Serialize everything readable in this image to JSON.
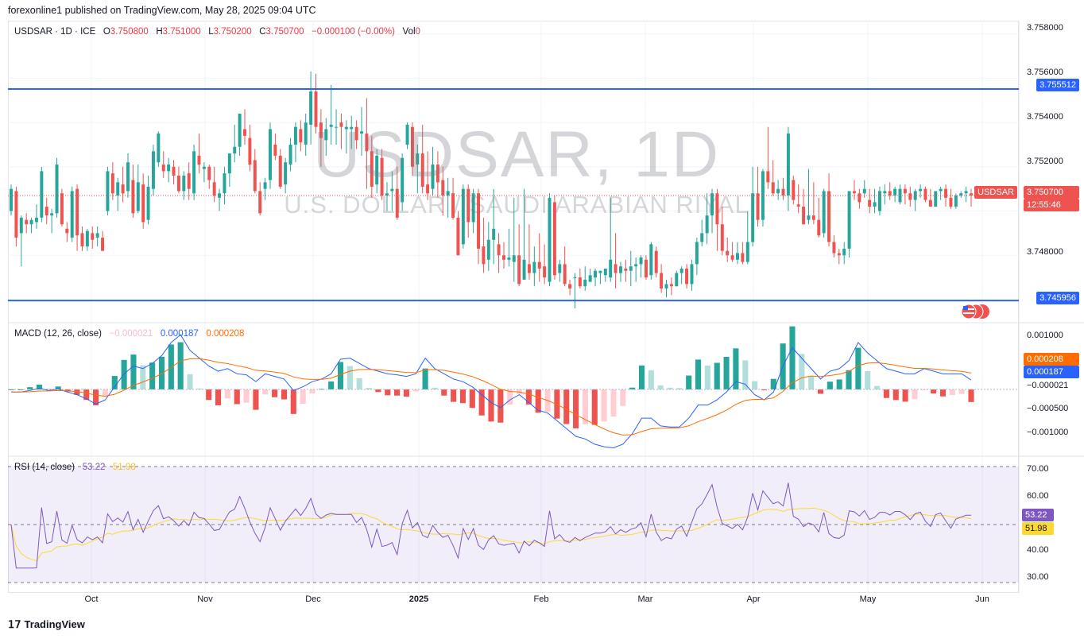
{
  "publisher_line": "forexonline1 published on TradingView.com, May 28, 2025 09:04 UTC",
  "brand": "TradingView",
  "watermark": {
    "ticker": "USDSAR, 1D",
    "description": "U.S. DOLLAR / SAUDI ARABIAN RIYAL"
  },
  "legend": {
    "symbol": "USDSAR · 1D · ICE",
    "o_label": "O",
    "o_value": "3.750800",
    "h_label": "H",
    "h_value": "3.751000",
    "l_label": "L",
    "l_value": "3.750200",
    "c_label": "C",
    "c_value": "3.750700",
    "change": "−0.000100 (−0.00%)",
    "vol_label": "Vol",
    "vol_value": "0"
  },
  "macd_legend": {
    "name": "MACD (12, 26, close)",
    "hist": "−0.000021",
    "macd": "0.000187",
    "signal": "0.000208"
  },
  "rsi_legend": {
    "name": "RSI (14, close)",
    "rsi": "53.22",
    "ma": "51.98"
  },
  "price_axis": [
    "3.758000",
    "3.756000",
    "3.754000",
    "3.752000",
    "3.748000"
  ],
  "price_tags": {
    "resistance": "3.755512",
    "support": "3.745956",
    "symbol": "USDSAR",
    "last": "3.750700",
    "countdown": "12:55:46"
  },
  "macd_axis": [
    "0.001000",
    "−0.000500",
    "−0.001000"
  ],
  "macd_tags": {
    "signal": "0.000208",
    "macd": "0.000187",
    "hist": "−0.000021"
  },
  "rsi_axis": [
    "70.00",
    "60.00",
    "40.00",
    "30.00"
  ],
  "rsi_tags": {
    "rsi": "53.22",
    "ma": "51.98"
  },
  "x_axis": [
    "Oct",
    "Nov",
    "Dec",
    "2025",
    "Feb",
    "Mar",
    "Apr",
    "May",
    "Jun"
  ],
  "colors": {
    "up": "#26a69a",
    "down": "#ef5350",
    "level_line": "#2962ff",
    "macd_line": "#2962ff",
    "signal_line": "#ff6d00",
    "rsi_line": "#7e57c2",
    "rsi_ma": "#fdd835"
  },
  "chart_data": {
    "type": "candlestick",
    "symbol": "USDSAR",
    "timeframe": "1D",
    "ylim": [
      3.7451,
      3.7586
    ],
    "horizontal_levels": [
      3.755512,
      3.745956
    ],
    "last_close": 3.7507,
    "candles": [
      [
        3.75,
        3.7512,
        3.7498,
        3.751
      ],
      [
        3.7509,
        3.7511,
        3.7484,
        3.7488
      ],
      [
        3.749,
        3.7498,
        3.7475,
        3.7497
      ],
      [
        3.7496,
        3.7499,
        3.749,
        3.7494
      ],
      [
        3.7494,
        3.7497,
        3.749,
        3.7496
      ],
      [
        3.7495,
        3.7503,
        3.7492,
        3.7497
      ],
      [
        3.7497,
        3.752,
        3.7495,
        3.7518
      ],
      [
        3.7502,
        3.7506,
        3.7494,
        3.7498
      ],
      [
        3.7498,
        3.7501,
        3.749,
        3.7499
      ],
      [
        3.7499,
        3.7524,
        3.7497,
        3.7521
      ],
      [
        3.7508,
        3.751,
        3.7493,
        3.7494
      ],
      [
        3.7492,
        3.7495,
        3.7486,
        3.749
      ],
      [
        3.7488,
        3.7511,
        3.7486,
        3.7509
      ],
      [
        3.751,
        3.7512,
        3.7482,
        3.7489
      ],
      [
        3.749,
        3.7493,
        3.7482,
        3.7484
      ],
      [
        3.7484,
        3.7492,
        3.7482,
        3.7491
      ],
      [
        3.749,
        3.7493,
        3.7483,
        3.7487
      ],
      [
        3.7488,
        3.7493,
        3.7484,
        3.749
      ],
      [
        3.7488,
        3.7491,
        3.7482,
        3.7482
      ],
      [
        3.75,
        3.752,
        3.7498,
        3.7518
      ],
      [
        3.7517,
        3.7522,
        3.7505,
        3.7508
      ],
      [
        3.7507,
        3.7515,
        3.75,
        3.7513
      ],
      [
        3.7512,
        3.752,
        3.7504,
        3.7508
      ],
      [
        3.7509,
        3.7526,
        3.7506,
        3.7522
      ],
      [
        3.7514,
        3.7521,
        3.7497,
        3.7499
      ],
      [
        3.75,
        3.7521,
        3.7499,
        3.7513
      ],
      [
        3.7512,
        3.7517,
        3.7492,
        3.7495
      ],
      [
        3.7496,
        3.7516,
        3.7494,
        3.7511
      ],
      [
        3.751,
        3.753,
        3.7507,
        3.7527
      ],
      [
        3.7522,
        3.7536,
        3.752,
        3.7535
      ],
      [
        3.7521,
        3.7527,
        3.7515,
        3.7518
      ],
      [
        3.7518,
        3.7524,
        3.7513,
        3.7521
      ],
      [
        3.752,
        3.7523,
        3.7512,
        3.7516
      ],
      [
        3.7516,
        3.752,
        3.7508,
        3.7509
      ],
      [
        3.7509,
        3.7518,
        3.7505,
        3.7516
      ],
      [
        3.7517,
        3.7522,
        3.7505,
        3.751
      ],
      [
        3.7508,
        3.753,
        3.7505,
        3.7527
      ],
      [
        3.7525,
        3.7535,
        3.7517,
        3.7521
      ],
      [
        3.7519,
        3.7522,
        3.7513,
        3.752
      ],
      [
        3.752,
        3.7521,
        3.751,
        3.7514
      ],
      [
        3.7513,
        3.752,
        3.7504,
        3.7507
      ],
      [
        3.7506,
        3.751,
        3.75,
        3.7508
      ],
      [
        3.7508,
        3.752,
        3.7503,
        3.7517
      ],
      [
        3.7517,
        3.7526,
        3.7511,
        3.7526
      ],
      [
        3.7526,
        3.7539,
        3.7522,
        3.7529
      ],
      [
        3.7529,
        3.7544,
        3.7525,
        3.7544
      ],
      [
        3.7537,
        3.7546,
        3.753,
        3.7534
      ],
      [
        3.7533,
        3.7539,
        3.7518,
        3.7521
      ],
      [
        3.7523,
        3.7528,
        3.7508,
        3.7509
      ],
      [
        3.7509,
        3.7513,
        3.7498,
        3.7499
      ],
      [
        3.751,
        3.7515,
        3.7505,
        3.7513
      ],
      [
        3.7514,
        3.754,
        3.751,
        3.7537
      ],
      [
        3.753,
        3.7535,
        3.7523,
        3.7525
      ],
      [
        3.7525,
        3.7528,
        3.751,
        3.7511
      ],
      [
        3.7512,
        3.7524,
        3.7508,
        3.7522
      ],
      [
        3.7521,
        3.7533,
        3.7518,
        3.753
      ],
      [
        3.753,
        3.754,
        3.7522,
        3.7538
      ],
      [
        3.7537,
        3.7541,
        3.7527,
        3.7531
      ],
      [
        3.753,
        3.7544,
        3.7525,
        3.754
      ],
      [
        3.7539,
        3.7563,
        3.753,
        3.7554
      ],
      [
        3.7554,
        3.7562,
        3.7535,
        3.7538
      ],
      [
        3.754,
        3.7546,
        3.752,
        3.7533
      ],
      [
        3.7532,
        3.7542,
        3.7525,
        3.7537
      ],
      [
        3.7538,
        3.7557,
        3.753,
        3.7539
      ],
      [
        3.7538,
        3.7546,
        3.753,
        3.7538
      ],
      [
        3.754,
        3.7544,
        3.7528,
        3.7538
      ],
      [
        3.7537,
        3.7541,
        3.7526,
        3.7538
      ],
      [
        3.7537,
        3.7543,
        3.7528,
        3.7538
      ],
      [
        3.7538,
        3.7541,
        3.7528,
        3.7532
      ],
      [
        3.7535,
        3.7547,
        3.7525,
        3.7536
      ],
      [
        3.7535,
        3.7551,
        3.751,
        3.7527
      ],
      [
        3.7527,
        3.7534,
        3.7506,
        3.7511
      ],
      [
        3.7512,
        3.7528,
        3.7508,
        3.7525
      ],
      [
        3.7524,
        3.7528,
        3.7505,
        3.7507
      ],
      [
        3.7507,
        3.7513,
        3.75,
        3.7508
      ],
      [
        3.7509,
        3.7518,
        3.75,
        3.751
      ],
      [
        3.751,
        3.752,
        3.7496,
        3.7497
      ],
      [
        3.7504,
        3.7526,
        3.75,
        3.7524
      ],
      [
        3.753,
        3.754,
        3.7528,
        3.7539
      ],
      [
        3.7538,
        3.754,
        3.7516,
        3.752
      ],
      [
        3.7521,
        3.753,
        3.7508,
        3.7526
      ],
      [
        3.7526,
        3.7539,
        3.7508,
        3.7511
      ],
      [
        3.7512,
        3.7527,
        3.7505,
        3.7508
      ],
      [
        3.751,
        3.7529,
        3.7507,
        3.7521
      ],
      [
        3.7521,
        3.7527,
        3.7506,
        3.7513
      ],
      [
        3.7514,
        3.752,
        3.7498,
        3.7507
      ],
      [
        3.7507,
        3.7515,
        3.7497,
        3.7509
      ],
      [
        3.7508,
        3.7515,
        3.7496,
        3.7497
      ],
      [
        3.7497,
        3.75,
        3.748,
        3.748
      ],
      [
        3.7485,
        3.7512,
        3.7483,
        3.751
      ],
      [
        3.751,
        3.7512,
        3.7488,
        3.7495
      ],
      [
        3.7495,
        3.751,
        3.749,
        3.7508
      ],
      [
        3.7508,
        3.751,
        3.7476,
        3.7483
      ],
      [
        3.7484,
        3.7497,
        3.7472,
        3.7476
      ],
      [
        3.7478,
        3.7495,
        3.7473,
        3.7487
      ],
      [
        3.7487,
        3.751,
        3.7476,
        3.7492
      ],
      [
        3.7485,
        3.749,
        3.7472,
        3.748
      ],
      [
        3.748,
        3.7486,
        3.7474,
        3.7478
      ],
      [
        3.7478,
        3.7492,
        3.7475,
        3.7479
      ],
      [
        3.7477,
        3.7506,
        3.7468,
        3.748
      ],
      [
        3.748,
        3.7494,
        3.7466,
        3.7467
      ],
      [
        3.7469,
        3.751,
        3.7469,
        3.7478
      ],
      [
        3.7476,
        3.7494,
        3.7469,
        3.7472
      ],
      [
        3.7472,
        3.7484,
        3.7466,
        3.7477
      ],
      [
        3.7477,
        3.749,
        3.7468,
        3.7474
      ],
      [
        3.7475,
        3.7485,
        3.7467,
        3.747
      ],
      [
        3.7468,
        3.7508,
        3.7466,
        3.7506
      ],
      [
        3.7504,
        3.7507,
        3.7469,
        3.7471
      ],
      [
        3.7472,
        3.7478,
        3.7468,
        3.7476
      ],
      [
        3.7476,
        3.7484,
        3.7466,
        3.7467
      ],
      [
        3.7467,
        3.7469,
        3.7462,
        3.7465
      ],
      [
        3.747,
        3.7472,
        3.7456,
        3.747
      ],
      [
        3.747,
        3.7474,
        3.7465,
        3.7466
      ],
      [
        3.7466,
        3.7475,
        3.7464,
        3.7469
      ],
      [
        3.7468,
        3.7474,
        3.7468,
        3.7471
      ],
      [
        3.747,
        3.7474,
        3.7466,
        3.7473
      ],
      [
        3.7472,
        3.7473,
        3.7467,
        3.7473
      ],
      [
        3.7471,
        3.7474,
        3.7468,
        3.7474
      ],
      [
        3.747,
        3.7506,
        3.7468,
        3.7478
      ],
      [
        3.7476,
        3.749,
        3.7465,
        3.7472
      ],
      [
        3.7472,
        3.7477,
        3.7468,
        3.7475
      ],
      [
        3.7474,
        3.7478,
        3.7468,
        3.7473
      ],
      [
        3.7473,
        3.7482,
        3.7466,
        3.7475
      ],
      [
        3.7475,
        3.7479,
        3.7468,
        3.7476
      ],
      [
        3.7476,
        3.748,
        3.747,
        3.7479
      ],
      [
        3.7478,
        3.748,
        3.7469,
        3.747
      ],
      [
        3.7471,
        3.7486,
        3.7469,
        3.7485
      ],
      [
        3.7482,
        3.7484,
        3.747,
        3.7472
      ],
      [
        3.7472,
        3.7476,
        3.7463,
        3.7465
      ],
      [
        3.7465,
        3.7469,
        3.7461,
        3.7467
      ],
      [
        3.7467,
        3.747,
        3.7462,
        3.7466
      ],
      [
        3.7466,
        3.7473,
        3.7466,
        3.7472
      ],
      [
        3.7472,
        3.7475,
        3.7467,
        3.7474
      ],
      [
        3.7474,
        3.7476,
        3.7465,
        3.7467
      ],
      [
        3.7467,
        3.7478,
        3.7464,
        3.7476
      ],
      [
        3.7476,
        3.7488,
        3.7471,
        3.7486
      ],
      [
        3.7486,
        3.7496,
        3.7484,
        3.749
      ],
      [
        3.749,
        3.7508,
        3.7485,
        3.7498
      ],
      [
        3.7498,
        3.751,
        3.749,
        3.7508
      ],
      [
        3.7508,
        3.751,
        3.7482,
        3.7494
      ],
      [
        3.7494,
        3.7502,
        3.748,
        3.7482
      ],
      [
        3.7482,
        3.7488,
        3.7477,
        3.748
      ],
      [
        3.748,
        3.7486,
        3.7477,
        3.7478
      ],
      [
        3.7478,
        3.7486,
        3.7476,
        3.7481
      ],
      [
        3.7481,
        3.7486,
        3.7476,
        3.7477
      ],
      [
        3.7477,
        3.75,
        3.7476,
        3.7486
      ],
      [
        3.7486,
        3.752,
        3.7484,
        3.7508
      ],
      [
        3.7508,
        3.752,
        3.7493,
        3.7496
      ],
      [
        3.7496,
        3.7519,
        3.7493,
        3.7518
      ],
      [
        3.7518,
        3.7538,
        3.751,
        3.7513
      ],
      [
        3.7513,
        3.7523,
        3.7507,
        3.7508
      ],
      [
        3.7508,
        3.7514,
        3.7505,
        3.751
      ],
      [
        3.751,
        3.7515,
        3.7505,
        3.7507
      ],
      [
        3.7507,
        3.7538,
        3.75,
        3.7535
      ],
      [
        3.7514,
        3.7516,
        3.7503,
        3.7505
      ],
      [
        3.7503,
        3.7512,
        3.7499,
        3.7502
      ],
      [
        3.7502,
        3.751,
        3.7494,
        3.7494
      ],
      [
        3.7496,
        3.7519,
        3.7494,
        3.7498
      ],
      [
        3.7498,
        3.7513,
        3.7494,
        3.7496
      ],
      [
        3.7496,
        3.7506,
        3.7488,
        3.7489
      ],
      [
        3.749,
        3.751,
        3.7488,
        3.7509
      ],
      [
        3.7509,
        3.7517,
        3.7484,
        3.7486
      ],
      [
        3.7486,
        3.7489,
        3.7479,
        3.7481
      ],
      [
        3.7481,
        3.7483,
        3.7476,
        3.748
      ],
      [
        3.748,
        3.7486,
        3.7476,
        3.7483
      ],
      [
        3.7483,
        3.7508,
        3.7479,
        3.7509
      ],
      [
        3.7509,
        3.7514,
        3.7505,
        3.7508
      ],
      [
        3.7508,
        3.751,
        3.7501,
        3.7504
      ],
      [
        3.7508,
        3.7514,
        3.7506,
        3.751
      ],
      [
        3.7505,
        3.751,
        3.7499,
        3.7502
      ],
      [
        3.7502,
        3.751,
        3.7499,
        3.7504
      ],
      [
        3.75,
        3.7511,
        3.7498,
        3.7509
      ],
      [
        3.7508,
        3.7512,
        3.7503,
        3.7509
      ],
      [
        3.7509,
        3.7513,
        3.7505,
        3.7507
      ],
      [
        3.7507,
        3.7511,
        3.7504,
        3.751
      ],
      [
        3.7504,
        3.7512,
        3.7503,
        3.751
      ],
      [
        3.751,
        3.7512,
        3.7503,
        3.7508
      ],
      [
        3.7508,
        3.7511,
        3.7502,
        3.7505
      ],
      [
        3.7505,
        3.751,
        3.75,
        3.7509
      ],
      [
        3.7509,
        3.7512,
        3.7506,
        3.751
      ],
      [
        3.751,
        3.7511,
        3.7504,
        3.7505
      ],
      [
        3.7505,
        3.751,
        3.7502,
        3.7502
      ],
      [
        3.7502,
        3.7508,
        3.7502,
        3.7509
      ],
      [
        3.7509,
        3.7511,
        3.7505,
        3.751
      ],
      [
        3.751,
        3.7512,
        3.7502,
        3.7506
      ],
      [
        3.7506,
        3.751,
        3.7501,
        3.7502
      ],
      [
        3.7502,
        3.7508,
        3.7501,
        3.7507
      ],
      [
        3.7507,
        3.7509,
        3.7506,
        3.7508
      ],
      [
        3.7508,
        3.7511,
        3.7504,
        3.7509
      ],
      [
        3.7508,
        3.751,
        3.7502,
        3.7507
      ]
    ],
    "macd": {
      "title": "MACD (12, 26, close)",
      "ylim": [
        -0.00125,
        0.00125
      ],
      "macd_line": [
        -5e-05,
        -5e-05,
        -2e-05,
        2e-05,
        -2e-05,
        1e-05,
        -5e-05,
        -0.0001,
        -0.00018,
        -0.00028,
        -0.0002,
        5e-05,
        0.0003,
        0.00045,
        0.0004,
        0.0005,
        0.00065,
        0.0009,
        0.00105,
        0.00075,
        0.0006,
        0.00045,
        0.00035,
        0.0004,
        0.0003,
        0.00028,
        0.00015,
        0.0003,
        0.00025,
        0.0002,
        -2e-05,
        5e-05,
        0.00015,
        0.0002,
        0.0003,
        0.00058,
        0.0006,
        0.0005,
        0.0004,
        0.00035,
        0.0003,
        0.00028,
        0.00025,
        0.0003,
        0.0006,
        0.0004,
        0.0003,
        0.0002,
        0.00015,
        5e-05,
        -0.0001,
        -0.00025,
        -0.00035,
        -0.0002,
        -0.0001,
        -0.00025,
        -0.0004,
        -0.00045,
        -0.0006,
        -0.00075,
        -0.0009,
        -0.00095,
        -0.00105,
        -0.0011,
        -0.00112,
        -0.00105,
        -0.00085,
        -0.00055,
        -0.00055,
        -0.0007,
        -0.00072,
        -0.00072,
        -0.00055,
        -0.0003,
        -0.0003,
        -0.0002,
        -5e-05,
        0.00015,
        0.0001,
        -0.0001,
        -0.0002,
        -5e-05,
        0.00045,
        0.0008,
        0.0006,
        0.0004,
        0.0002,
        0.00035,
        0.0004,
        0.00055,
        0.0009,
        0.0007,
        0.00055,
        0.0004,
        0.00035,
        0.0003,
        0.0003,
        0.0004,
        0.00035,
        0.0003,
        0.0003,
        0.0003,
        0.00018
      ]
    },
    "rsi": {
      "title": "RSI (14, close)",
      "ylim": [
        27,
        73
      ],
      "bands": [
        70,
        50,
        30
      ],
      "last": 53.22,
      "ma_last": 51.98
    }
  }
}
